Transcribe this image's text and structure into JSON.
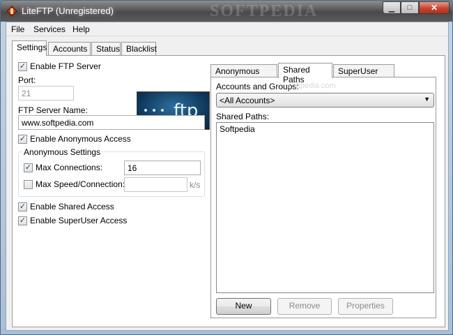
{
  "window": {
    "title": "LiteFTP (Unregistered)",
    "watermark": "SOFTPEDIA",
    "controls": {
      "minimize": "▁",
      "maximize": "□",
      "close": "✕"
    }
  },
  "menu": [
    "File",
    "Services",
    "Help"
  ],
  "main_tabs": [
    "Settings",
    "Accounts",
    "Status",
    "Blacklist"
  ],
  "settings": {
    "enable_ftp_server": {
      "label": "Enable FTP Server",
      "checked": true
    },
    "port": {
      "label": "Port:",
      "value": "21"
    },
    "logo_text": "ftp",
    "server_name": {
      "label": "FTP Server Name:",
      "value": "www.softpedia.com"
    },
    "enable_anonymous": {
      "label": "Enable Anonymous Access",
      "checked": true
    },
    "anonymous_settings": {
      "title": "Anonymous Settings",
      "max_connections": {
        "label": "Max Connections:",
        "checked": true,
        "value": "16"
      },
      "max_speed": {
        "label": "Max Speed/Connection:",
        "checked": false,
        "value": "",
        "unit": "k/s"
      }
    },
    "enable_shared": {
      "label": "Enable Shared Access",
      "checked": true
    },
    "enable_superuser": {
      "label": "Enable SuperUser Access",
      "checked": true
    }
  },
  "path_tabs": [
    "Anonymous Paths",
    "Shared Paths",
    "SuperUser Paths"
  ],
  "shared_paths": {
    "accounts_label": "Accounts and Groups:",
    "accounts_selected": "<All Accounts>",
    "paths_label": "Shared Paths:",
    "items": [
      "Softpedia"
    ],
    "faint_watermark": "softpedia.com",
    "buttons": {
      "new": "New",
      "remove": "Remove",
      "properties": "Properties"
    }
  }
}
